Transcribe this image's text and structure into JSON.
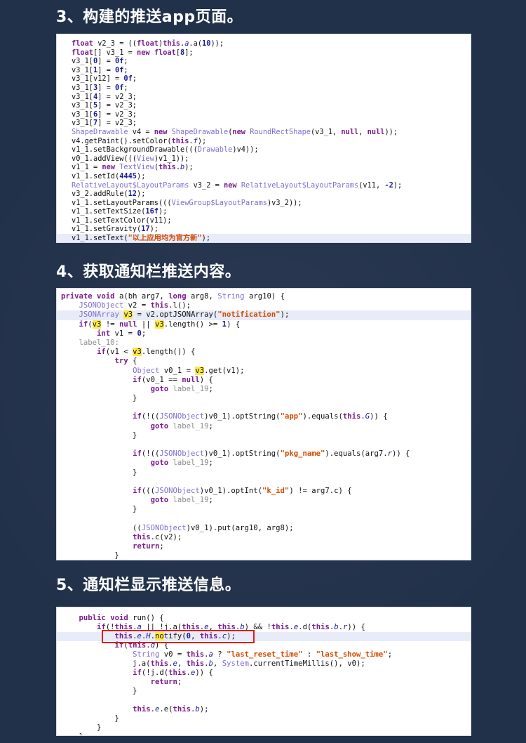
{
  "sections": [
    {
      "heading": "3、构建的推送app页面。"
    },
    {
      "heading": "4、获取通知栏推送内容。"
    },
    {
      "heading": "5、通知栏显示推送信息。"
    }
  ],
  "code1": [
    [
      [
        "kw",
        "float"
      ],
      [
        "t",
        " v2_3 = (("
      ],
      [
        "kw",
        "float"
      ],
      [
        "t",
        ")"
      ],
      [
        "kw",
        "this"
      ],
      [
        "t",
        "."
      ],
      [
        "fld",
        "a"
      ],
      [
        "t",
        "."
      ],
      [
        "t",
        "a("
      ],
      [
        "num",
        "10"
      ],
      [
        "t",
        "));"
      ]
    ],
    [
      [
        "kw",
        "float"
      ],
      [
        "t",
        "[] v3_1 = "
      ],
      [
        "kw",
        "new"
      ],
      [
        "t",
        " "
      ],
      [
        "kw",
        "float"
      ],
      [
        "t",
        "["
      ],
      [
        "num",
        "8"
      ],
      [
        "t",
        "];"
      ]
    ],
    [
      [
        "t",
        "v3_1["
      ],
      [
        "num",
        "0"
      ],
      [
        "t",
        "] = "
      ],
      [
        "num",
        "0f"
      ],
      [
        "t",
        ";"
      ]
    ],
    [
      [
        "t",
        "v3_1["
      ],
      [
        "num",
        "1"
      ],
      [
        "t",
        "] = "
      ],
      [
        "num",
        "0f"
      ],
      [
        "t",
        ";"
      ]
    ],
    [
      [
        "t",
        "v3_1[v12] = "
      ],
      [
        "num",
        "0f"
      ],
      [
        "t",
        ";"
      ]
    ],
    [
      [
        "t",
        "v3_1["
      ],
      [
        "num",
        "3"
      ],
      [
        "t",
        "] = "
      ],
      [
        "num",
        "0f"
      ],
      [
        "t",
        ";"
      ]
    ],
    [
      [
        "t",
        "v3_1["
      ],
      [
        "num",
        "4"
      ],
      [
        "t",
        "] = v2_3;"
      ]
    ],
    [
      [
        "t",
        "v3_1["
      ],
      [
        "num",
        "5"
      ],
      [
        "t",
        "] = v2_3;"
      ]
    ],
    [
      [
        "t",
        "v3_1["
      ],
      [
        "num",
        "6"
      ],
      [
        "t",
        "] = v2_3;"
      ]
    ],
    [
      [
        "t",
        "v3_1["
      ],
      [
        "num",
        "7"
      ],
      [
        "t",
        "] = v2_3;"
      ]
    ],
    [
      [
        "ty",
        "ShapeDrawable"
      ],
      [
        "t",
        " v4 = "
      ],
      [
        "kw",
        "new"
      ],
      [
        "t",
        " "
      ],
      [
        "ty",
        "ShapeDrawable"
      ],
      [
        "t",
        "("
      ],
      [
        "kw",
        "new"
      ],
      [
        "t",
        " "
      ],
      [
        "ty",
        "RoundRectShape"
      ],
      [
        "t",
        "(v3_1, "
      ],
      [
        "kw",
        "null"
      ],
      [
        "t",
        ", "
      ],
      [
        "kw",
        "null"
      ],
      [
        "t",
        "));"
      ]
    ],
    [
      [
        "t",
        "v4.getPaint().setColor("
      ],
      [
        "kw",
        "this"
      ],
      [
        "t",
        "."
      ],
      [
        "fld",
        "f"
      ],
      [
        "t",
        ");"
      ]
    ],
    [
      [
        "t",
        "v1_1.setBackgroundDrawable((("
      ],
      [
        "ty",
        "Drawable"
      ],
      [
        "t",
        ")v4));"
      ]
    ],
    [
      [
        "t",
        "v0_1.addView((("
      ],
      [
        "ty",
        "View"
      ],
      [
        "t",
        ")v1_1));"
      ]
    ],
    [
      [
        "t",
        "v1_1 = "
      ],
      [
        "kw",
        "new"
      ],
      [
        "t",
        " "
      ],
      [
        "ty",
        "TextView"
      ],
      [
        "t",
        "("
      ],
      [
        "kw",
        "this"
      ],
      [
        "t",
        "."
      ],
      [
        "fld",
        "b"
      ],
      [
        "t",
        ");"
      ]
    ],
    [
      [
        "t",
        "v1_1.setId("
      ],
      [
        "num",
        "4445"
      ],
      [
        "t",
        ");"
      ]
    ],
    [
      [
        "ty",
        "RelativeLayout$LayoutParams"
      ],
      [
        "t",
        " v3_2 = "
      ],
      [
        "kw",
        "new"
      ],
      [
        "t",
        " "
      ],
      [
        "ty",
        "RelativeLayout$LayoutParams"
      ],
      [
        "t",
        "(v11, "
      ],
      [
        "num",
        "-2"
      ],
      [
        "t",
        ");"
      ]
    ],
    [
      [
        "t",
        "v3_2.addRule("
      ],
      [
        "num",
        "12"
      ],
      [
        "t",
        ");"
      ]
    ],
    [
      [
        "t",
        "v1_1.setLayoutParams((("
      ],
      [
        "ty",
        "ViewGroup$LayoutParams"
      ],
      [
        "t",
        ")v3_2));"
      ]
    ],
    [
      [
        "t",
        "v1_1.setTextSize("
      ],
      [
        "num",
        "16f"
      ],
      [
        "t",
        ");"
      ]
    ],
    [
      [
        "t",
        "v1_1.setTextColor(v11);"
      ]
    ],
    [
      [
        "t",
        "v1_1.setGravity("
      ],
      [
        "num",
        "17"
      ],
      [
        "t",
        ");"
      ]
    ],
    [
      [
        "t",
        "v1_1.setText("
      ],
      [
        "strr",
        "\"以上应用均为官方新\""
      ],
      [
        "t",
        ");"
      ]
    ]
  ],
  "code2": [
    [
      [
        "kw",
        "private"
      ],
      [
        "t",
        " "
      ],
      [
        "kw",
        "void"
      ],
      [
        "t",
        " a(bh arg7, "
      ],
      [
        "kw",
        "long"
      ],
      [
        "t",
        " arg8, "
      ],
      [
        "ty",
        "String"
      ],
      [
        "t",
        " arg10) {"
      ]
    ],
    [
      [
        "t",
        "    "
      ],
      [
        "ty",
        "JSONObject"
      ],
      [
        "t",
        " v2 = "
      ],
      [
        "kw",
        "this"
      ],
      [
        "t",
        ".l();"
      ]
    ],
    [
      [
        "t",
        "    "
      ],
      [
        "ty",
        "JSONArray"
      ],
      [
        "t",
        " "
      ],
      [
        "mark",
        "v3"
      ],
      [
        "t",
        " = v2.optJSONArray("
      ],
      [
        "strr",
        "\"notification\""
      ],
      [
        "t",
        ");"
      ]
    ],
    [
      [
        "t",
        "    "
      ],
      [
        "kw",
        "if"
      ],
      [
        "t",
        "("
      ],
      [
        "mark",
        "v3"
      ],
      [
        "t",
        " != "
      ],
      [
        "kw",
        "null"
      ],
      [
        "t",
        " || "
      ],
      [
        "mark",
        "v3"
      ],
      [
        "t",
        ".length() >= "
      ],
      [
        "num",
        "1"
      ],
      [
        "t",
        ") {"
      ]
    ],
    [
      [
        "t",
        "        "
      ],
      [
        "kw",
        "int"
      ],
      [
        "t",
        " v1 = "
      ],
      [
        "num",
        "0"
      ],
      [
        "t",
        ";"
      ]
    ],
    [
      [
        "t",
        "    "
      ],
      [
        "lbl",
        "label_10:"
      ]
    ],
    [
      [
        "t",
        "        "
      ],
      [
        "kw",
        "if"
      ],
      [
        "t",
        "(v1 < "
      ],
      [
        "mark",
        "v3"
      ],
      [
        "t",
        ".length()) {"
      ]
    ],
    [
      [
        "t",
        "            "
      ],
      [
        "kw",
        "try"
      ],
      [
        "t",
        " {"
      ]
    ],
    [
      [
        "t",
        "                "
      ],
      [
        "ty",
        "Object"
      ],
      [
        "t",
        " v0_1 = "
      ],
      [
        "mark",
        "v3"
      ],
      [
        "t",
        ".get(v1);"
      ]
    ],
    [
      [
        "t",
        "                "
      ],
      [
        "kw",
        "if"
      ],
      [
        "t",
        "(v0_1 == "
      ],
      [
        "kw",
        "null"
      ],
      [
        "t",
        ") {"
      ]
    ],
    [
      [
        "t",
        "                    "
      ],
      [
        "kw",
        "goto"
      ],
      [
        "t",
        " "
      ],
      [
        "lbl",
        "label_19"
      ],
      [
        "t",
        ";"
      ]
    ],
    [
      [
        "t",
        "                }"
      ]
    ],
    [
      [
        "t",
        ""
      ]
    ],
    [
      [
        "t",
        "                "
      ],
      [
        "kw",
        "if"
      ],
      [
        "t",
        "(!(("
      ],
      [
        "ty",
        "JSONObject"
      ],
      [
        "t",
        ")v0_1).optString("
      ],
      [
        "strr",
        "\"app\""
      ],
      [
        "t",
        ").equals("
      ],
      [
        "kw",
        "this"
      ],
      [
        "t",
        "."
      ],
      [
        "fld",
        "G"
      ],
      [
        "t",
        ")) {"
      ]
    ],
    [
      [
        "t",
        "                    "
      ],
      [
        "kw",
        "goto"
      ],
      [
        "t",
        " "
      ],
      [
        "lbl",
        "label_19"
      ],
      [
        "t",
        ";"
      ]
    ],
    [
      [
        "t",
        "                }"
      ]
    ],
    [
      [
        "t",
        ""
      ]
    ],
    [
      [
        "t",
        "                "
      ],
      [
        "kw",
        "if"
      ],
      [
        "t",
        "(!(("
      ],
      [
        "ty",
        "JSONObject"
      ],
      [
        "t",
        ")v0_1).optString("
      ],
      [
        "strr",
        "\"pkg_name\""
      ],
      [
        "t",
        ").equals(arg7."
      ],
      [
        "fld",
        "r"
      ],
      [
        "t",
        ")) {"
      ]
    ],
    [
      [
        "t",
        "                    "
      ],
      [
        "kw",
        "goto"
      ],
      [
        "t",
        " "
      ],
      [
        "lbl",
        "label_19"
      ],
      [
        "t",
        ";"
      ]
    ],
    [
      [
        "t",
        "                }"
      ]
    ],
    [
      [
        "t",
        ""
      ]
    ],
    [
      [
        "t",
        "                "
      ],
      [
        "kw",
        "if"
      ],
      [
        "t",
        "((("
      ],
      [
        "ty",
        "JSONObject"
      ],
      [
        "t",
        ")v0_1).optInt("
      ],
      [
        "strr",
        "\"k_id\""
      ],
      [
        "t",
        ") != arg7.c) {"
      ]
    ],
    [
      [
        "t",
        "                    "
      ],
      [
        "kw",
        "goto"
      ],
      [
        "t",
        " "
      ],
      [
        "lbl",
        "label_19"
      ],
      [
        "t",
        ";"
      ]
    ],
    [
      [
        "t",
        "                }"
      ]
    ],
    [
      [
        "t",
        ""
      ]
    ],
    [
      [
        "t",
        "                (("
      ],
      [
        "ty",
        "JSONObject"
      ],
      [
        "t",
        ")v0_1).put(arg10, arg8);"
      ]
    ],
    [
      [
        "t",
        "                "
      ],
      [
        "kw",
        "this"
      ],
      [
        "t",
        ".c(v2);"
      ]
    ],
    [
      [
        "t",
        "                "
      ],
      [
        "kw",
        "return"
      ],
      [
        "t",
        ";"
      ]
    ],
    [
      [
        "t",
        "            }"
      ]
    ]
  ],
  "code3": [
    [
      [
        "t",
        "    "
      ],
      [
        "kw",
        "public"
      ],
      [
        "t",
        " "
      ],
      [
        "kw",
        "void"
      ],
      [
        "t",
        " run() {"
      ]
    ],
    [
      [
        "t",
        "        "
      ],
      [
        "kw",
        "if"
      ],
      [
        "t",
        "(!"
      ],
      [
        "kw",
        "this"
      ],
      [
        "t",
        "."
      ],
      [
        "fld",
        "a"
      ],
      [
        "t",
        " || !j.a("
      ],
      [
        "kw",
        "this"
      ],
      [
        "t",
        "."
      ],
      [
        "fld",
        "e"
      ],
      [
        "t",
        ", "
      ],
      [
        "kw",
        "this"
      ],
      [
        "t",
        "."
      ],
      [
        "fld",
        "b"
      ],
      [
        "t",
        ") && !"
      ],
      [
        "kw",
        "this"
      ],
      [
        "t",
        "."
      ],
      [
        "fld",
        "e"
      ],
      [
        "t",
        ".d("
      ],
      [
        "kw",
        "this"
      ],
      [
        "t",
        "."
      ],
      [
        "fld",
        "b"
      ],
      [
        "t",
        "."
      ],
      [
        "fld",
        "r"
      ],
      [
        "t",
        ")) {"
      ]
    ],
    [
      [
        "t",
        "            "
      ],
      [
        "kw",
        "this"
      ],
      [
        "t",
        "."
      ],
      [
        "fld",
        "e"
      ],
      [
        "t",
        "."
      ],
      [
        "fld",
        "H"
      ],
      [
        "t",
        "."
      ],
      [
        "mark",
        "no"
      ],
      [
        "t",
        "tify("
      ],
      [
        "num",
        "0"
      ],
      [
        "t",
        ", "
      ],
      [
        "kw",
        "this"
      ],
      [
        "t",
        "."
      ],
      [
        "fld",
        "c"
      ],
      [
        "t",
        ");"
      ]
    ],
    [
      [
        "t",
        "            "
      ],
      [
        "kw",
        "if"
      ],
      [
        "t",
        "("
      ],
      [
        "kw",
        "this"
      ],
      [
        "t",
        "."
      ],
      [
        "fld",
        "d"
      ],
      [
        "t",
        ") {"
      ]
    ],
    [
      [
        "t",
        "                "
      ],
      [
        "ty",
        "String"
      ],
      [
        "t",
        " v0 = "
      ],
      [
        "kw",
        "this"
      ],
      [
        "t",
        "."
      ],
      [
        "fld",
        "a"
      ],
      [
        "t",
        " ? "
      ],
      [
        "strr",
        "\"last_reset_time\""
      ],
      [
        "t",
        " : "
      ],
      [
        "strr",
        "\"last_show_time\""
      ],
      [
        "t",
        ";"
      ]
    ],
    [
      [
        "t",
        "                j.a("
      ],
      [
        "kw",
        "this"
      ],
      [
        "t",
        "."
      ],
      [
        "fld",
        "e"
      ],
      [
        "t",
        ", "
      ],
      [
        "kw",
        "this"
      ],
      [
        "t",
        "."
      ],
      [
        "fld",
        "b"
      ],
      [
        "t",
        ", "
      ],
      [
        "ty",
        "System"
      ],
      [
        "t",
        ".currentTimeMillis(), v0);"
      ]
    ],
    [
      [
        "t",
        "                "
      ],
      [
        "kw",
        "if"
      ],
      [
        "t",
        "(!j.d("
      ],
      [
        "kw",
        "this"
      ],
      [
        "t",
        "."
      ],
      [
        "fld",
        "e"
      ],
      [
        "t",
        ")) {"
      ]
    ],
    [
      [
        "t",
        "                    "
      ],
      [
        "kw",
        "return"
      ],
      [
        "t",
        ";"
      ]
    ],
    [
      [
        "t",
        "                }"
      ]
    ],
    [
      [
        "t",
        ""
      ]
    ],
    [
      [
        "t",
        "                "
      ],
      [
        "kw",
        "this"
      ],
      [
        "t",
        "."
      ],
      [
        "fld",
        "e"
      ],
      [
        "t",
        ".e("
      ],
      [
        "kw",
        "this"
      ],
      [
        "t",
        "."
      ],
      [
        "fld",
        "b"
      ],
      [
        "t",
        ");"
      ]
    ],
    [
      [
        "t",
        "            }"
      ]
    ],
    [
      [
        "t",
        "        }"
      ]
    ],
    [
      [
        "t",
        "    }"
      ]
    ]
  ]
}
